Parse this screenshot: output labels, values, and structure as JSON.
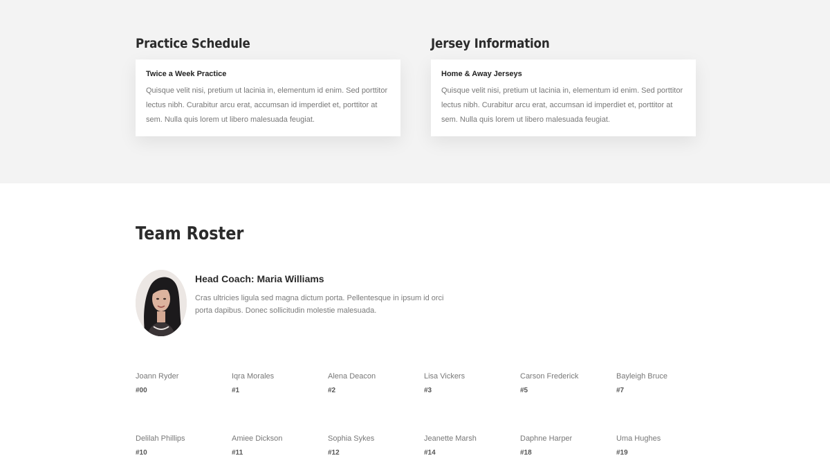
{
  "info": {
    "practice": {
      "heading": "Practice Schedule",
      "card_title": "Twice a Week Practice",
      "card_body": "Quisque velit nisi, pretium ut lacinia in, elementum id enim. Sed porttitor lectus nibh. Curabitur arcu erat, accumsan id imperdiet et, porttitor at sem. Nulla quis lorem ut libero malesuada feugiat."
    },
    "jersey": {
      "heading": "Jersey Information",
      "card_title": "Home & Away Jerseys",
      "card_body": "Quisque velit nisi, pretium ut lacinia in, elementum id enim. Sed porttitor lectus nibh. Curabitur arcu erat, accumsan id imperdiet et, porttitor at sem. Nulla quis lorem ut libero malesuada feugiat."
    }
  },
  "roster": {
    "heading": "Team Roster",
    "coach": {
      "name": "Head Coach: Maria Williams",
      "bio": "Cras ultricies ligula sed magna dictum porta. Pellentesque in ipsum id orci porta dapibus. Donec sollicitudin molestie malesuada."
    },
    "players": [
      {
        "name": "Joann Ryder",
        "number": "#00"
      },
      {
        "name": "Iqra Morales",
        "number": "#1"
      },
      {
        "name": "Alena Deacon",
        "number": "#2"
      },
      {
        "name": "Lisa Vickers",
        "number": "#3"
      },
      {
        "name": "Carson Frederick",
        "number": "#5"
      },
      {
        "name": "Bayleigh Bruce",
        "number": "#7"
      },
      {
        "name": "Delilah Phillips",
        "number": "#10"
      },
      {
        "name": "Amiee Dickson",
        "number": "#11"
      },
      {
        "name": "Sophia Sykes",
        "number": "#12"
      },
      {
        "name": "Jeanette Marsh",
        "number": "#14"
      },
      {
        "name": "Daphne Harper",
        "number": "#18"
      },
      {
        "name": "Uma Hughes",
        "number": "#19"
      }
    ]
  },
  "colors": {
    "top_background": "#f3f3f3",
    "heading": "#2b2b2b",
    "body_text": "#777777"
  }
}
